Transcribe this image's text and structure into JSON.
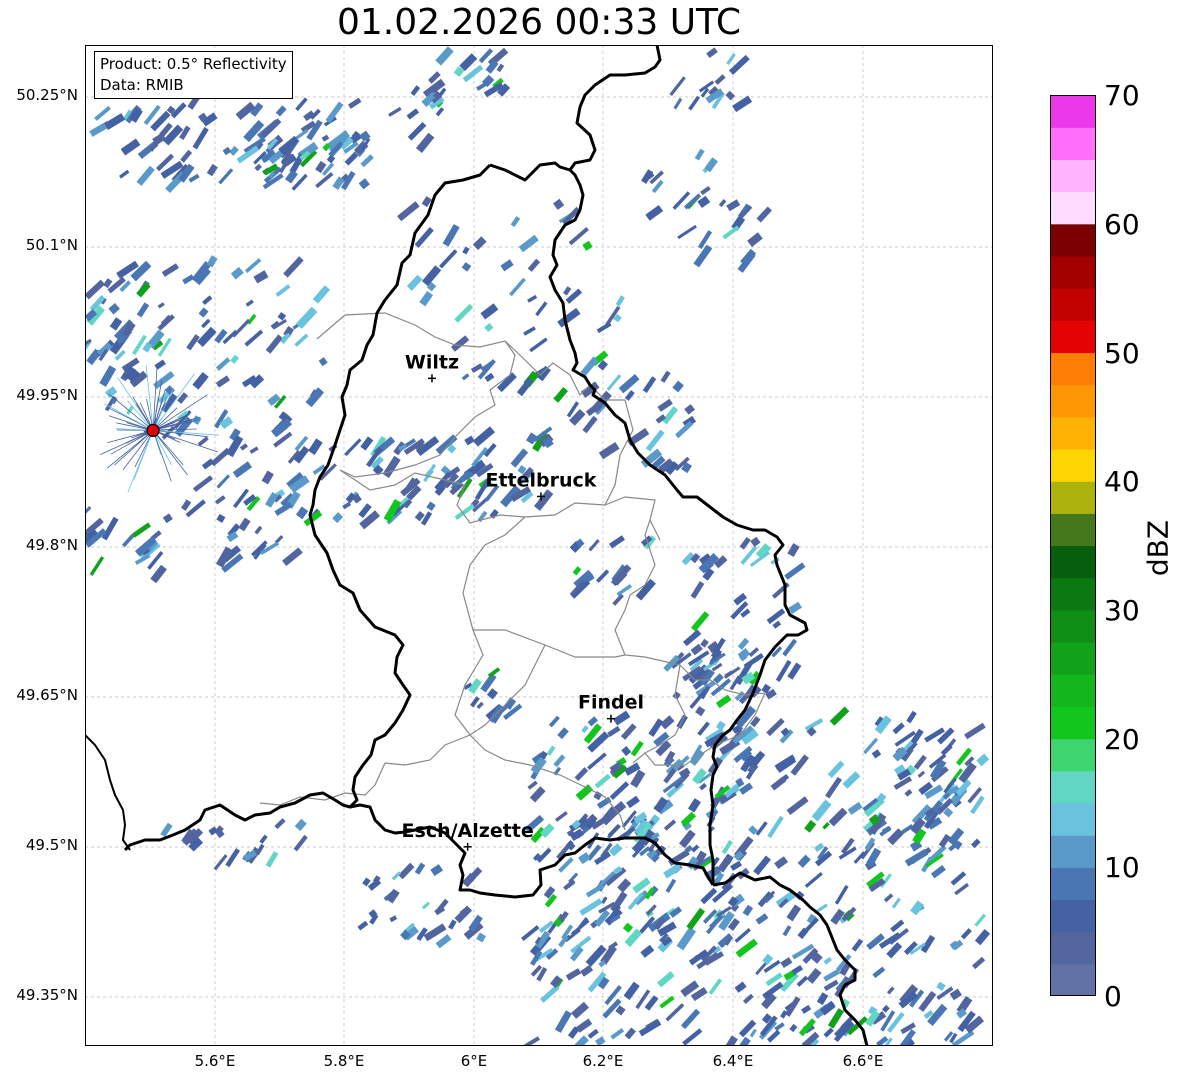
{
  "title": "01.02.2026 00:33 UTC",
  "info": {
    "product": "Product: 0.5° Reflectivity",
    "data": "Data: RMIB"
  },
  "lat_labels": [
    "50.25°N",
    "50.1°N",
    "49.95°N",
    "49.8°N",
    "49.65°N",
    "49.5°N",
    "49.35°N"
  ],
  "lon_labels": [
    "5.6°E",
    "5.8°E",
    "6°E",
    "6.2°E",
    "6.4°E",
    "6.6°E"
  ],
  "cities": [
    {
      "name": "Wiltz",
      "lon": 5.935,
      "lat": 49.967
    },
    {
      "name": "Ettelbruck",
      "lon": 6.103,
      "lat": 49.849
    },
    {
      "name": "Findel",
      "lon": 6.211,
      "lat": 49.627
    },
    {
      "name": "Esch/Alzette",
      "lon": 5.99,
      "lat": 49.499
    }
  ],
  "radar_site": {
    "lon": 5.505,
    "lat": 49.915
  },
  "map_extent": {
    "lon_min": 5.4,
    "lon_max": 6.8,
    "lat_min": 49.3,
    "lat_max": 50.3
  },
  "colorbar": {
    "label": "dBZ",
    "min": 0,
    "max": 70,
    "step": 2.5,
    "ticks": [
      "0",
      "10",
      "20",
      "30",
      "40",
      "50",
      "60",
      "70"
    ],
    "colors": [
      "#6272a7",
      "#52659f",
      "#4461a4",
      "#4a77b3",
      "#5a9ac9",
      "#69c2de",
      "#61d6c5",
      "#3dd56f",
      "#13c61d",
      "#13b71c",
      "#12a21a",
      "#0f8e16",
      "#0b7812",
      "#075e0d",
      "#44781b",
      "#adb20f",
      "#fdd502",
      "#fdb203",
      "#fe9702",
      "#fe7d03",
      "#e20302",
      "#c20101",
      "#a30000",
      "#7b0001",
      "#ffdcff",
      "#ffb3ff",
      "#ff6ff9",
      "#ea38ea"
    ]
  }
}
